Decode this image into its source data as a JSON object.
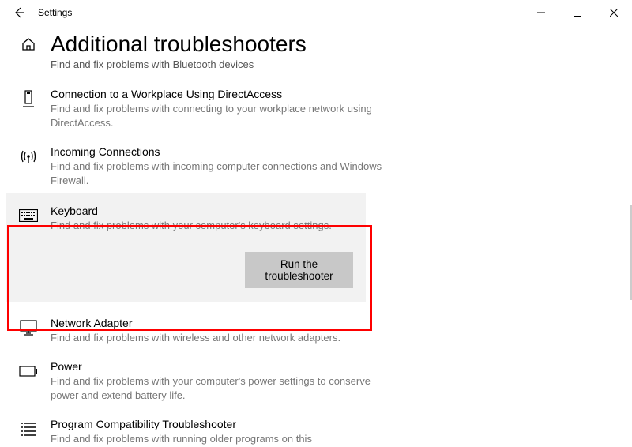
{
  "window": {
    "title": "Settings"
  },
  "page": {
    "title": "Additional troubleshooters",
    "orphanDesc": "Find and fix problems with Bluetooth devices"
  },
  "items": {
    "directaccess": {
      "title": "Connection to a Workplace Using DirectAccess",
      "desc": "Find and fix problems with connecting to your workplace network using DirectAccess."
    },
    "incoming": {
      "title": "Incoming Connections",
      "desc": "Find and fix problems with incoming computer connections and Windows Firewall."
    },
    "keyboard": {
      "title": "Keyboard",
      "desc": "Find and fix problems with your computer's keyboard settings.",
      "button": "Run the troubleshooter"
    },
    "network": {
      "title": "Network Adapter",
      "desc": "Find and fix problems with wireless and other network adapters."
    },
    "power": {
      "title": "Power",
      "desc": "Find and fix problems with your computer's power settings to conserve power and extend battery life."
    },
    "compat": {
      "title": "Program Compatibility Troubleshooter",
      "desc": "Find and fix problems with running older programs on this"
    }
  }
}
